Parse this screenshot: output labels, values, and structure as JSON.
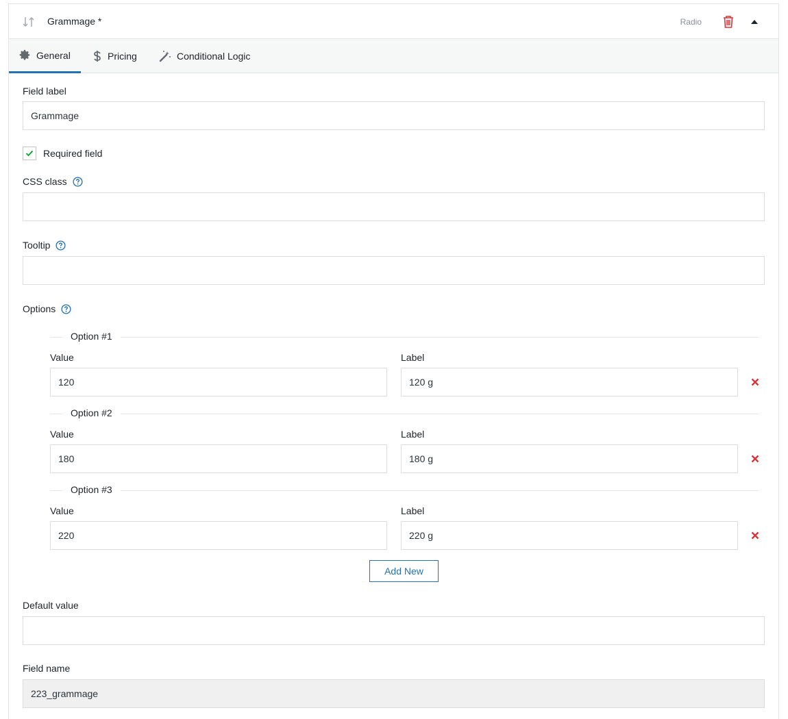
{
  "header": {
    "title": "Grammage *",
    "type": "Radio"
  },
  "tabs": [
    {
      "label": "General",
      "icon": "gear-icon"
    },
    {
      "label": "Pricing",
      "icon": "dollar-icon"
    },
    {
      "label": "Conditional Logic",
      "icon": "magic-wand-icon"
    }
  ],
  "field_label": {
    "label": "Field label",
    "value": "Grammage"
  },
  "required": {
    "label": "Required field",
    "checked": true
  },
  "css_class": {
    "label": "CSS class",
    "value": ""
  },
  "tooltip": {
    "label": "Tooltip",
    "value": ""
  },
  "options": {
    "label": "Options",
    "value_label": "Value",
    "label_label": "Label",
    "items": [
      {
        "title": "Option #1",
        "value": "120",
        "label": "120 g"
      },
      {
        "title": "Option #2",
        "value": "180",
        "label": "180 g"
      },
      {
        "title": "Option #3",
        "value": "220",
        "label": "220 g"
      }
    ],
    "add_new": "Add New"
  },
  "default_value": {
    "label": "Default value",
    "value": ""
  },
  "field_name": {
    "label": "Field name",
    "value": "223_grammage"
  },
  "colors": {
    "accent": "#2271b1",
    "danger": "#d63638",
    "check": "#00a32a"
  }
}
